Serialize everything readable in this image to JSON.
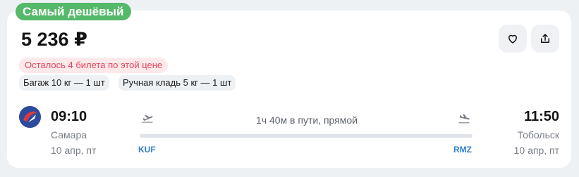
{
  "badge": "Самый дешёвый",
  "price": "5 236 ₽",
  "actions": {
    "favorite_icon": "heart-icon",
    "share_icon": "share-icon"
  },
  "tickets_left": "Осталось 4 билета по этой цене",
  "baggage": [
    "Багаж 10 кг — 1 шт",
    "Ручная кладь 5 кг — 1 шт"
  ],
  "flight": {
    "departure": {
      "time": "09:10",
      "city": "Самара",
      "date": "10 апр, пт",
      "code": "KUF"
    },
    "arrival": {
      "time": "11:50",
      "city": "Тобольск",
      "date": "10 апр, пт",
      "code": "RMZ"
    },
    "duration": "1ч 40м в пути, прямой"
  },
  "colors": {
    "badge": "#55b96a",
    "warning_text": "#e0475a",
    "airport_code": "#2f7fd1"
  }
}
